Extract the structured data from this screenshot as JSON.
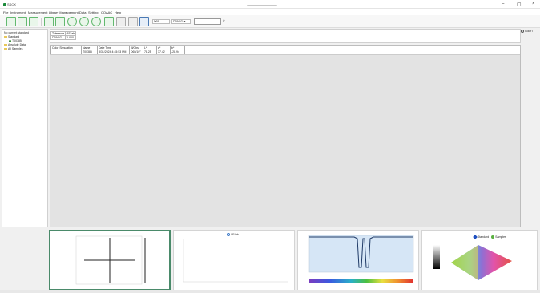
{
  "window": {
    "title": "SSCX",
    "minimize": "–",
    "maximize": "▢",
    "close": "×"
  },
  "menu": [
    "File",
    "Instrument",
    "Measurement",
    "Library Management",
    "Data",
    "Setting",
    "COAAC",
    "Help"
  ],
  "toolbar": {
    "illuminant": "D65",
    "observer": "D65/10° ▾",
    "search_value": ""
  },
  "tree": {
    "no_standard": "No current standard",
    "standard": "Standard",
    "child": "T00385",
    "absolute": "Absolute Data",
    "all": "All Samples"
  },
  "tolerance": {
    "headers": [
      "Tolerance",
      "ΔE*ab"
    ],
    "row": [
      "D65/10°",
      "1.000"
    ]
  },
  "color_panel_label": "Color i",
  "grid": {
    "columns": [
      "Color Simulation",
      "Name",
      "Date Time",
      "Ill/Obs",
      "L*",
      "a*",
      "b*"
    ],
    "row": [
      "",
      "T00385",
      "3/31/2024 4:45:53 PM",
      "D65/10°",
      "78.25",
      "37.42",
      "-28.94"
    ]
  },
  "panels": {
    "de_legend": "ΔE*ab",
    "legend_standard": "Standard",
    "legend_samples": "Samples"
  }
}
